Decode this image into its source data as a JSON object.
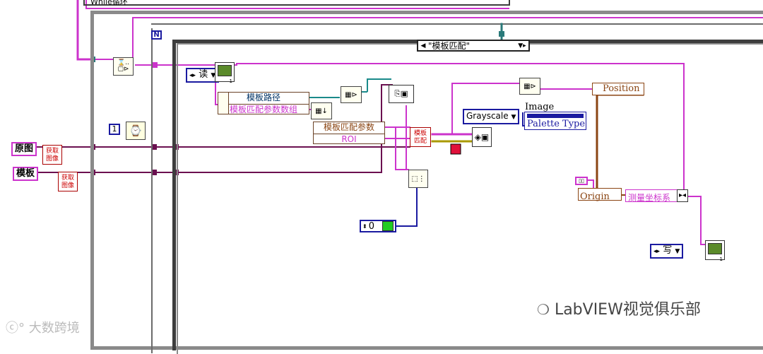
{
  "loop": {
    "while_label": "While循环",
    "for_label": "N"
  },
  "case_structure": {
    "selector_value": "\"模板匹配\""
  },
  "controls": {
    "original_image": "原图",
    "template_image": "模板"
  },
  "subvis": {
    "get_image_1": "获取图像",
    "get_image_2": "获取图像",
    "template_match": "模板匹配"
  },
  "enums": {
    "read_mode": "读",
    "write_mode": "写"
  },
  "constants": {
    "wait_ms": "1",
    "numeric_zero": "0"
  },
  "bundle_template": {
    "path_label": "模板路径",
    "params_array_label": "模板匹配参数数组"
  },
  "bundle_match": {
    "params_label": "模板匹配参数",
    "roi_label": "ROI"
  },
  "image_props": {
    "type_ring": "Grayscale",
    "image_label": "Image",
    "palette_label": "Palette Type"
  },
  "coords": {
    "position_label": "Position",
    "origin_label": "Origin",
    "system_label": "测量坐标系"
  },
  "watermarks": {
    "left": "大数跨境",
    "right": "LabVIEW视觉俱乐部"
  },
  "colors": {
    "wire_image": "#cc33cc",
    "wire_cluster": "#8b4513",
    "wire_numeric": "#1a1aa0",
    "wire_dark": "#6b1050",
    "structure_gray": "#8a8a8a"
  }
}
